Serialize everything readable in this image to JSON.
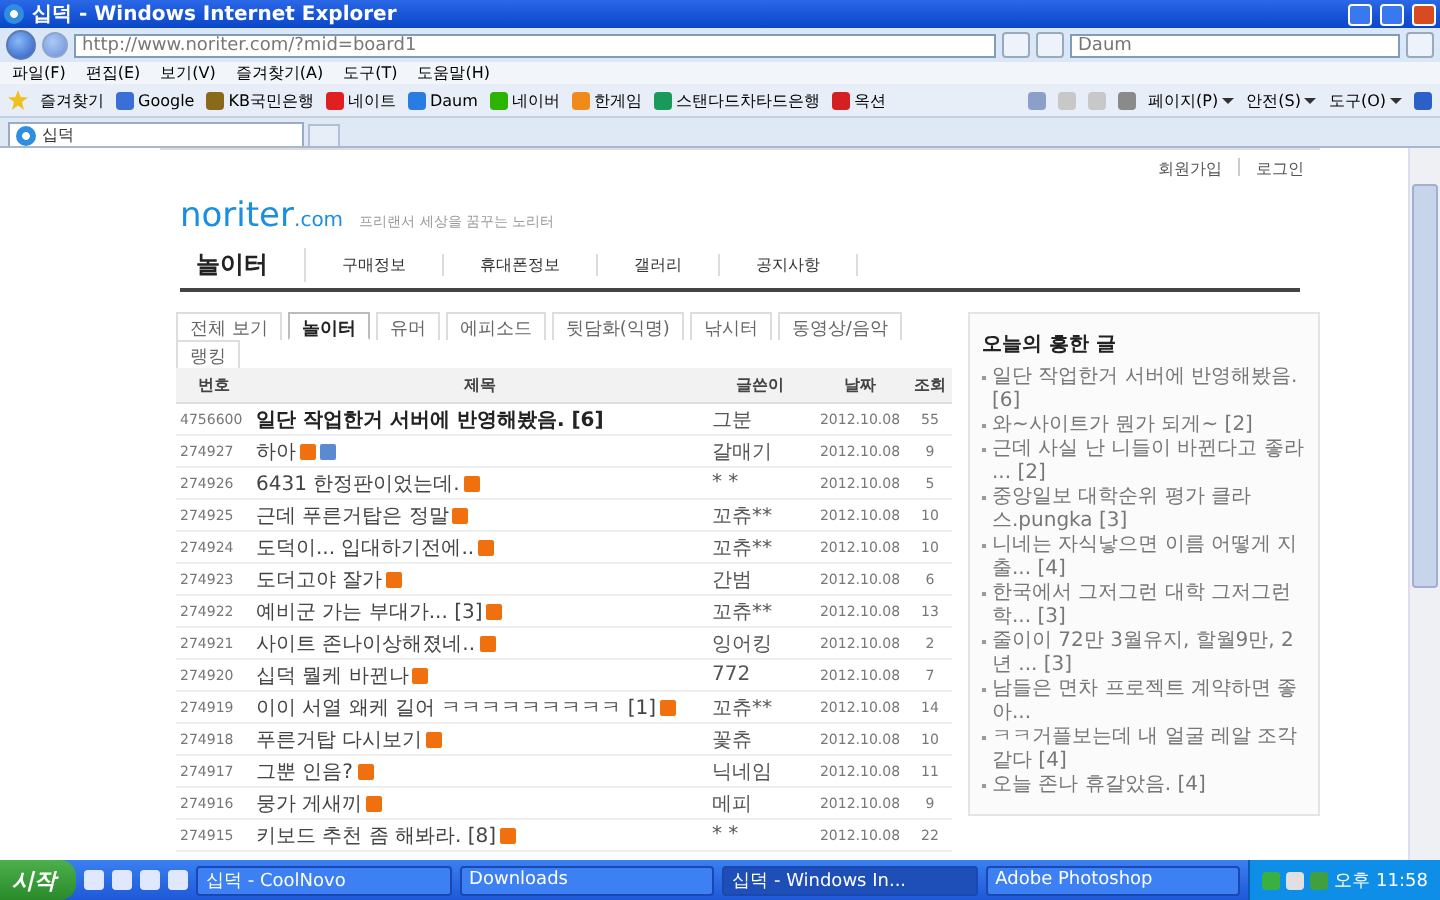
{
  "window": {
    "title": "십덕 - Windows Internet Explorer"
  },
  "address_bar": {
    "url": "http://www.noriter.com/?mid=board1",
    "search_placeholder": "Daum"
  },
  "menu": [
    "파일(F)",
    "편집(E)",
    "보기(V)",
    "즐겨찾기(A)",
    "도구(T)",
    "도움말(H)"
  ],
  "favorites_bar": {
    "label": "즐겨찾기",
    "items": [
      {
        "label": "Google",
        "color": "#3b6fd8"
      },
      {
        "label": "KB국민은행",
        "color": "#8a6a1a"
      },
      {
        "label": "네이트",
        "color": "#e02020"
      },
      {
        "label": "Daum",
        "color": "#2a7de0"
      },
      {
        "label": "네이버",
        "color": "#2db400"
      },
      {
        "label": "한게임",
        "color": "#f08a1a"
      },
      {
        "label": "스탠다드차타드은행",
        "color": "#1a9a5a"
      },
      {
        "label": "옥션",
        "color": "#d42020"
      }
    ],
    "tools": [
      "페이지(P)",
      "안전(S)",
      "도구(O)"
    ]
  },
  "browser_tabs": [
    {
      "label": "십덕",
      "selected": true
    }
  ],
  "site": {
    "top_links": [
      "회원가입",
      "로그인"
    ],
    "logo": "noriter",
    "logo_suffix": ".com",
    "tagline": "프리랜서 세상을 꿈꾸는 노리터",
    "nav": [
      {
        "label": "놀이터",
        "selected": true
      },
      {
        "label": "구매정보",
        "selected": false
      },
      {
        "label": "휴대폰정보",
        "selected": false
      },
      {
        "label": "갤러리",
        "selected": false
      },
      {
        "label": "공지사항",
        "selected": false
      }
    ]
  },
  "board_tabs": [
    {
      "label": "전체 보기",
      "selected": false
    },
    {
      "label": "놀이터",
      "selected": true
    },
    {
      "label": "유머",
      "selected": false
    },
    {
      "label": "에피소드",
      "selected": false
    },
    {
      "label": "뒷담화(익명)",
      "selected": false
    },
    {
      "label": "낚시터",
      "selected": false
    },
    {
      "label": "동영상/음악",
      "selected": false
    },
    {
      "label": "랭킹",
      "selected": false
    }
  ],
  "table": {
    "columns": [
      "번호",
      "제목",
      "글쓴이",
      "날짜",
      "조회"
    ],
    "rows": [
      {
        "kind": "notice",
        "no": "4756600",
        "title": "일단 작업한거 서버에 반영해봤음. [6]",
        "new": false,
        "image": false,
        "writer": "그분",
        "date": "2012.10.08",
        "views": "55"
      },
      {
        "kind": "post",
        "no": "274927",
        "title": "하아",
        "new": true,
        "image": true,
        "writer": "갈매기",
        "date": "2012.10.08",
        "views": "9"
      },
      {
        "kind": "post",
        "no": "274926",
        "title": "6431 한정판이었는데.",
        "new": true,
        "image": false,
        "writer": "* *",
        "date": "2012.10.08",
        "views": "5"
      },
      {
        "kind": "post",
        "no": "274925",
        "title": "근데 푸른거탑은 정말",
        "new": true,
        "image": false,
        "writer": "꼬츄**",
        "date": "2012.10.08",
        "views": "10"
      },
      {
        "kind": "post",
        "no": "274924",
        "title": "도덕이... 입대하기전에..",
        "new": true,
        "image": false,
        "writer": "꼬츄**",
        "date": "2012.10.08",
        "views": "10"
      },
      {
        "kind": "post",
        "no": "274923",
        "title": "도더고야 잘가",
        "new": true,
        "image": false,
        "writer": "간범",
        "date": "2012.10.08",
        "views": "6"
      },
      {
        "kind": "post",
        "no": "274922",
        "title": "예비군 가는 부대가... [3]",
        "new": true,
        "image": false,
        "writer": "꼬츄**",
        "date": "2012.10.08",
        "views": "13"
      },
      {
        "kind": "post",
        "no": "274921",
        "title": "사이트 존나이상해졌네..",
        "new": true,
        "image": false,
        "writer": "잉어킹",
        "date": "2012.10.08",
        "views": "2"
      },
      {
        "kind": "post",
        "no": "274920",
        "title": "십덕 뭘케 바뀐나",
        "new": true,
        "image": false,
        "writer": "772",
        "date": "2012.10.08",
        "views": "7"
      },
      {
        "kind": "post",
        "no": "274919",
        "title": "이이 서열 왜케 길어 ㅋㅋㅋㅋㅋㅋㅋㅋㅋ [1]",
        "new": true,
        "image": false,
        "writer": "꼬츄**",
        "date": "2012.10.08",
        "views": "14"
      },
      {
        "kind": "post",
        "no": "274918",
        "title": "푸른거탑 다시보기",
        "new": true,
        "image": false,
        "writer": "꽃츄",
        "date": "2012.10.08",
        "views": "10"
      },
      {
        "kind": "post",
        "no": "274917",
        "title": "그뿐 인음?",
        "new": true,
        "image": false,
        "writer": "닉네임",
        "date": "2012.10.08",
        "views": "11"
      },
      {
        "kind": "post",
        "no": "274916",
        "title": "뭉가 게새끼",
        "new": true,
        "image": false,
        "writer": "메피",
        "date": "2012.10.08",
        "views": "9"
      },
      {
        "kind": "post",
        "no": "274915",
        "title": "키보드 추천 좀 해봐라. [8]",
        "new": true,
        "image": false,
        "writer": "* *",
        "date": "2012.10.08",
        "views": "22"
      }
    ]
  },
  "hot_posts": {
    "title": "오늘의 흥한 글",
    "items": [
      "일단 작업한거 서버에 반영해봤음. [6]",
      "와~사이트가 뭔가 되게~ [2]",
      "근데 사실 난 니들이 바뀐다고 좋라 ... [2]",
      "중앙일보 대학순위 평가 클라스.pungka [3]",
      "니네는 자식낳으면 이름 어떻게 지출... [4]",
      "한국에서 그저그런 대학 그저그런 학... [3]",
      "줄이이 72만 3월유지, 할월9만, 2년 ... [3]",
      "남들은 면차 프로젝트 계약하면 좋아...",
      "ㅋㅋ거플보는데 내 얼굴 레알 조각같다 [4]",
      "오늘 존나 휴갈았음. [4]"
    ]
  },
  "taskbar": {
    "start": "시작",
    "tasks": [
      {
        "label": "십덕 - CoolNovo",
        "selected": false
      },
      {
        "label": "Downloads",
        "selected": false
      },
      {
        "label": "십덕 - Windows In...",
        "selected": true
      },
      {
        "label": "Adobe Photoshop",
        "selected": false
      }
    ],
    "clock": "오후 11:58"
  }
}
